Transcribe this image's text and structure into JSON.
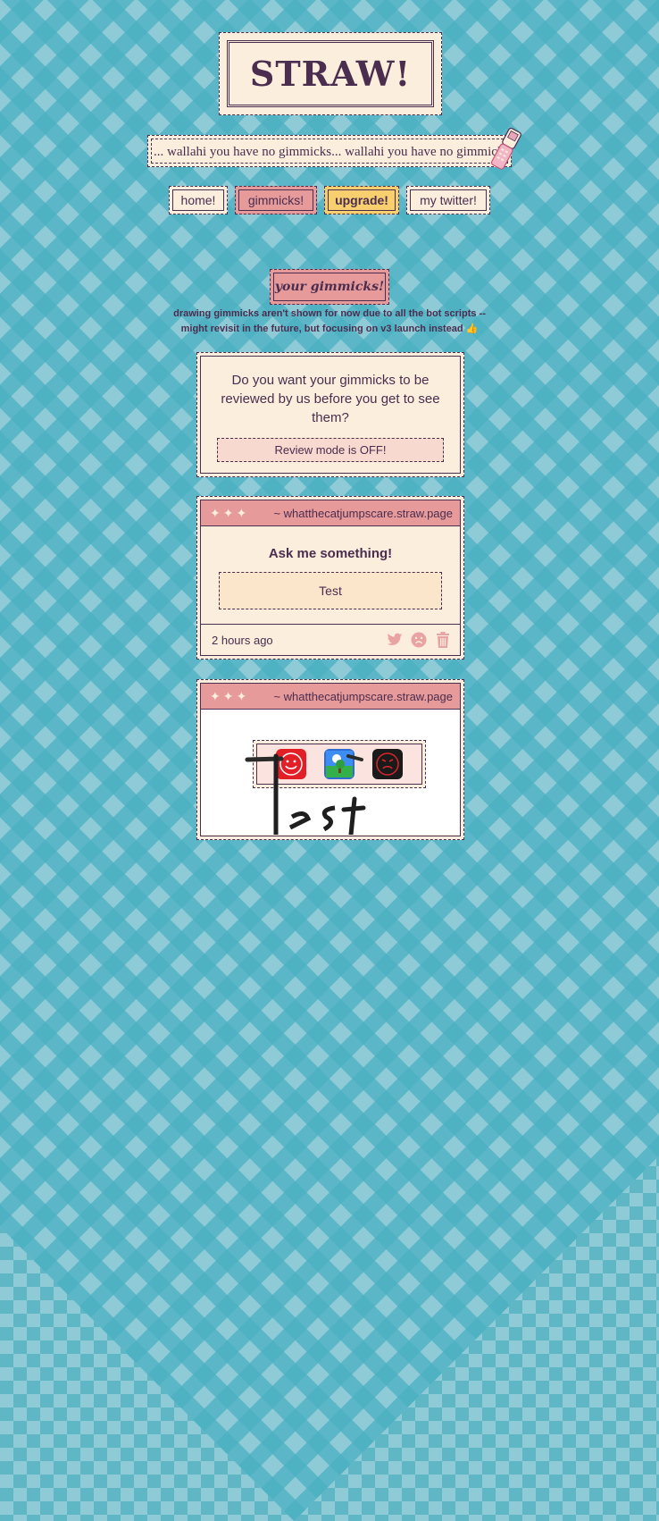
{
  "logo": {
    "text": "STRAW!"
  },
  "marquee": {
    "text": "...        wallahi you have no gimmicks...         wallahi you have no gimmicks...",
    "icon": "flip-phone-icon"
  },
  "nav": {
    "home": "home!",
    "gimmicks": "gimmicks!",
    "upgrade": "upgrade!",
    "twitter": "my twitter!"
  },
  "section": {
    "title": "your gimmicks!",
    "notice_line1": "drawing gimmicks aren't shown for now due to all the bot scripts --",
    "notice_line2": "might revisit in the future, but focusing on v3 launch instead 👍"
  },
  "review": {
    "question": "Do you want your gimmicks to be reviewed by us before you get to see them?",
    "toggle_label": "Review mode is OFF!"
  },
  "cards": [
    {
      "stars": "✦✦✦",
      "site": "~ whatthecatjumpscare.straw.page",
      "prompt": "Ask me something!",
      "answer": "Test",
      "time": "2 hours ago",
      "actions": [
        "twitter-icon",
        "frown-icon",
        "trash-icon"
      ]
    },
    {
      "stars": "✦✦✦",
      "site": "~ whatthecatjumpscare.straw.page",
      "drawing_text": "Test"
    }
  ],
  "colors": {
    "ink": "#4a2d4f",
    "cream": "#fbeedc",
    "pink": "#e69a9a",
    "yellow": "#f7cf6e",
    "teal_light": "#8ecbd6",
    "teal_dark": "#5fb6c4"
  }
}
